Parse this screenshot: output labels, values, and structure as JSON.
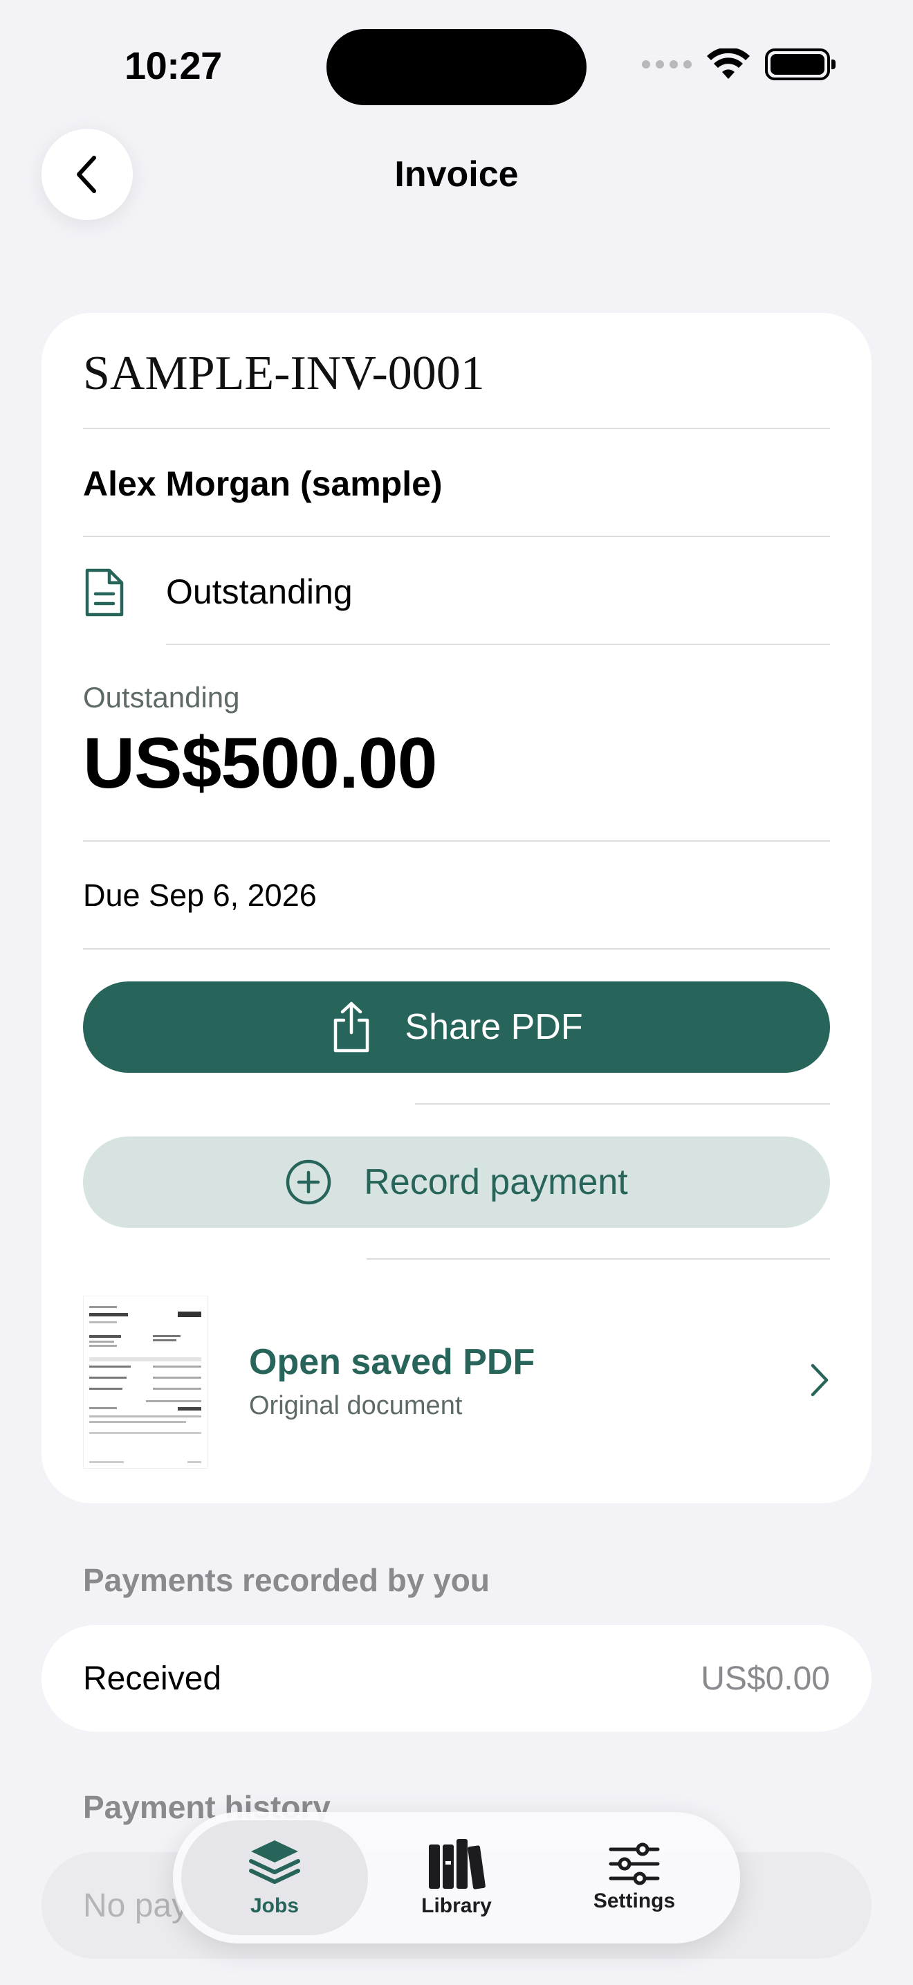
{
  "status_bar": {
    "time": "10:27"
  },
  "nav": {
    "title": "Invoice"
  },
  "invoice": {
    "number": "SAMPLE-INV-0001",
    "client": "Alex Morgan (sample)",
    "status": "Outstanding",
    "outstanding_label": "Outstanding",
    "amount": "US$500.00",
    "due": "Due Sep 6, 2026"
  },
  "actions": {
    "share_label": "Share PDF",
    "record_label": "Record payment"
  },
  "pdf": {
    "title": "Open saved PDF",
    "subtitle": "Original document"
  },
  "payments": {
    "section_title": "Payments recorded by you",
    "received_label": "Received",
    "received_value": "US$0.00"
  },
  "history": {
    "section_title": "Payment history",
    "empty_text": "No payments yet"
  },
  "tabs": [
    {
      "label": "Jobs",
      "icon": "stack-icon",
      "active": true
    },
    {
      "label": "Library",
      "icon": "books-icon",
      "active": false
    },
    {
      "label": "Settings",
      "icon": "sliders-icon",
      "active": false
    }
  ],
  "colors": {
    "accent": "#27645a",
    "accent_light": "#d6e3e0",
    "background": "#f2f2f7"
  }
}
